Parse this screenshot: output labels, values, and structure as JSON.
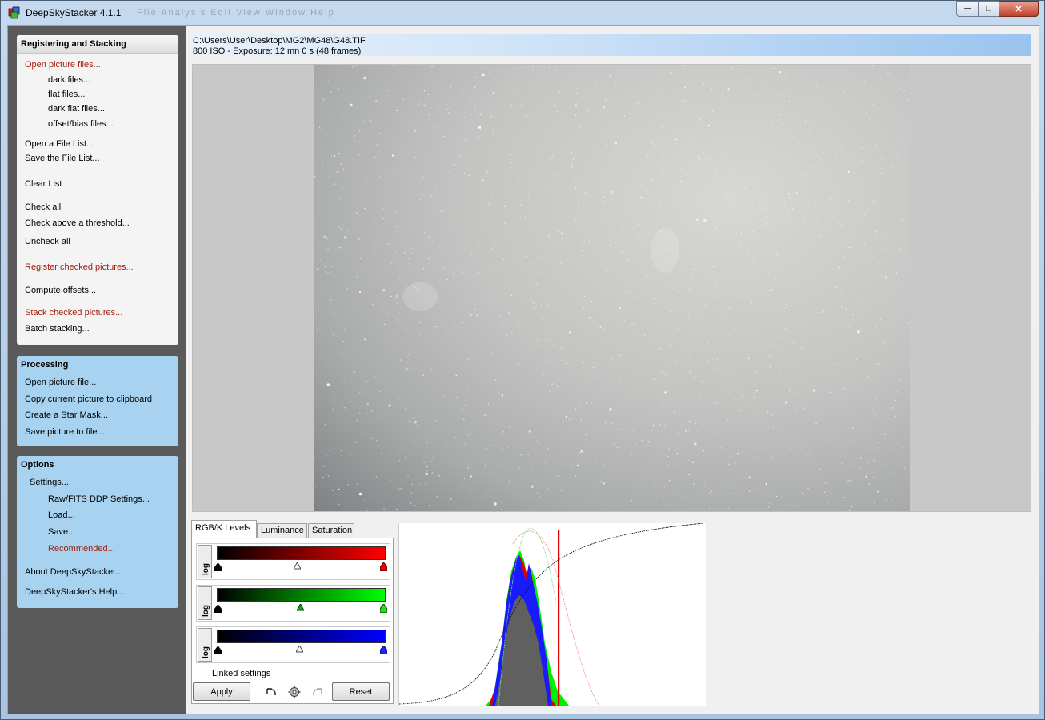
{
  "window": {
    "title": "DeepSkyStacker 4.1.1",
    "ghost_menu": "File   Analysis   Edit   View   Window   Help",
    "minimize": "─",
    "maximize": "□",
    "close": "✕"
  },
  "registering": {
    "title": "Registering and Stacking",
    "open_picture_files": "Open picture files...",
    "dark_files": "dark files...",
    "flat_files": "flat files...",
    "dark_flat_files": "dark flat files...",
    "offset_bias_files": "offset/bias files...",
    "open_file_list": "Open a File List...",
    "save_file_list": "Save the File List...",
    "clear_list": "Clear List",
    "check_all": "Check all",
    "check_above_threshold": "Check above a threshold...",
    "uncheck_all": "Uncheck all",
    "register_checked": "Register checked pictures...",
    "compute_offsets": "Compute offsets...",
    "stack_checked": "Stack checked pictures...",
    "batch_stacking": "Batch stacking..."
  },
  "processing": {
    "title": "Processing",
    "open_picture_file": "Open picture file...",
    "copy_to_clipboard": "Copy current picture to clipboard",
    "create_star_mask": "Create a Star Mask...",
    "save_picture": "Save picture to file..."
  },
  "options": {
    "title": "Options",
    "settings": "Settings...",
    "raw_fits": "Raw/FITS DDP Settings...",
    "load": "Load...",
    "save": "Save...",
    "recommended": "Recommended...",
    "about": "About DeepSkyStacker...",
    "help": "DeepSkyStacker's Help..."
  },
  "file_info": {
    "path": "C:\\Users\\User\\Desktop\\MG2\\MG48\\G48.TIF",
    "details": "800 ISO - Exposure: 12 mn 0 s (48 frames)"
  },
  "levels": {
    "tabs": [
      "RGB/K Levels",
      "Luminance",
      "Saturation"
    ],
    "log_label": "log",
    "linked_settings": "Linked settings",
    "apply": "Apply",
    "reset": "Reset",
    "colors": {
      "red": "#ff0000",
      "green": "#00ff00",
      "blue": "#0000ff"
    }
  },
  "icons": [
    "app-icon",
    "undo-icon",
    "settings-icon",
    "redo-icon"
  ]
}
